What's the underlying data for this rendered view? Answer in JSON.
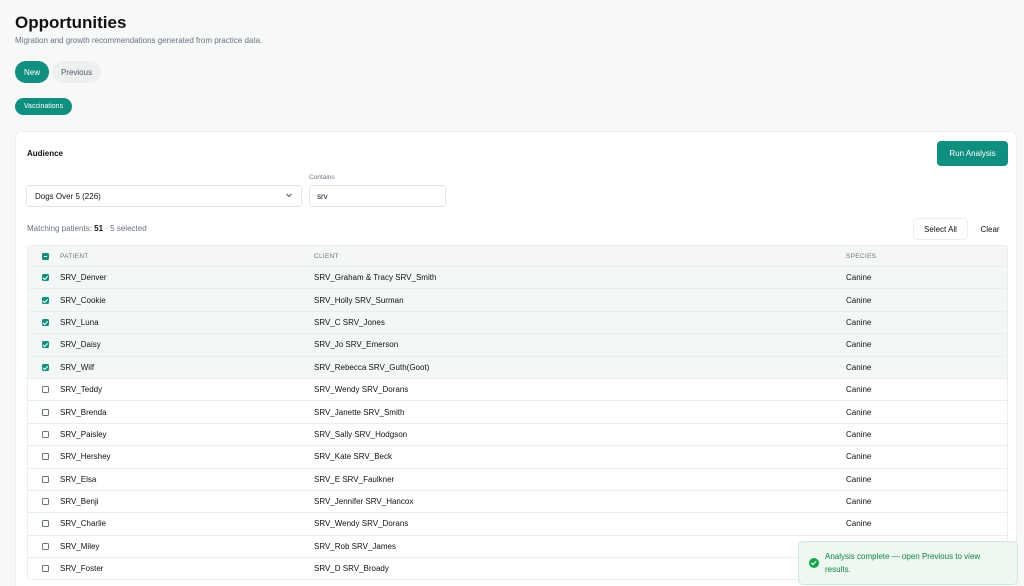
{
  "header": {
    "title": "Opportunities",
    "subtitle": "Migration and growth recommendations generated from practice data."
  },
  "tabs": [
    {
      "label": "New",
      "active": true
    },
    {
      "label": "Previous",
      "active": false
    }
  ],
  "category_chip": "Vaccinations",
  "audience": {
    "label": "Audience",
    "run_button": "Run Analysis",
    "segment_value": "Dogs Over 5 (226)",
    "contains_label": "Contains",
    "contains_value": "srv"
  },
  "matching": {
    "prefix": "Matching patients: ",
    "count": "51",
    "suffix": " · 5 selected",
    "select_all": "Select All",
    "clear": "Clear"
  },
  "table": {
    "columns": [
      "PATIENT",
      "CLIENT",
      "SPECIES"
    ],
    "rows": [
      {
        "patient": "SRV_Denver",
        "client": "SRV_Graham & Tracy SRV_Smith",
        "species": "Canine",
        "selected": true
      },
      {
        "patient": "SRV_Cookie",
        "client": "SRV_Holly SRV_Surman",
        "species": "Canine",
        "selected": true
      },
      {
        "patient": "SRV_Luna",
        "client": "SRV_C SRV_Jones",
        "species": "Canine",
        "selected": true
      },
      {
        "patient": "SRV_Daisy",
        "client": "SRV_Jo SRV_Emerson",
        "species": "Canine",
        "selected": true
      },
      {
        "patient": "SRV_Wilf",
        "client": "SRV_Rebecca SRV_Guth(Goot)",
        "species": "Canine",
        "selected": true
      },
      {
        "patient": "SRV_Teddy",
        "client": "SRV_Wendy SRV_Dorans",
        "species": "Canine",
        "selected": false
      },
      {
        "patient": "SRV_Brenda",
        "client": "SRV_Janette SRV_Smith",
        "species": "Canine",
        "selected": false
      },
      {
        "patient": "SRV_Paisley",
        "client": "SRV_Sally SRV_Hodgson",
        "species": "Canine",
        "selected": false
      },
      {
        "patient": "SRV_Hershey",
        "client": "SRV_Kate SRV_Beck",
        "species": "Canine",
        "selected": false
      },
      {
        "patient": "SRV_Elsa",
        "client": "SRV_E SRV_Faulkner",
        "species": "Canine",
        "selected": false
      },
      {
        "patient": "SRV_Benji",
        "client": "SRV_Jennifer SRV_Hancox",
        "species": "Canine",
        "selected": false
      },
      {
        "patient": "SRV_Charlie",
        "client": "SRV_Wendy SRV_Dorans",
        "species": "Canine",
        "selected": false
      },
      {
        "patient": "SRV_Miley",
        "client": "SRV_Rob SRV_James",
        "species": "",
        "selected": false
      },
      {
        "patient": "SRV_Foster",
        "client": "SRV_D SRV_Broady",
        "species": "",
        "selected": false
      }
    ]
  },
  "toast": {
    "message": "Analysis complete — open Previous to view results."
  },
  "colors": {
    "accent": "#108f80",
    "success": "#16a34a"
  },
  "icons": [
    "chevron-down-icon",
    "check-circle-icon",
    "checkbox-icon"
  ]
}
